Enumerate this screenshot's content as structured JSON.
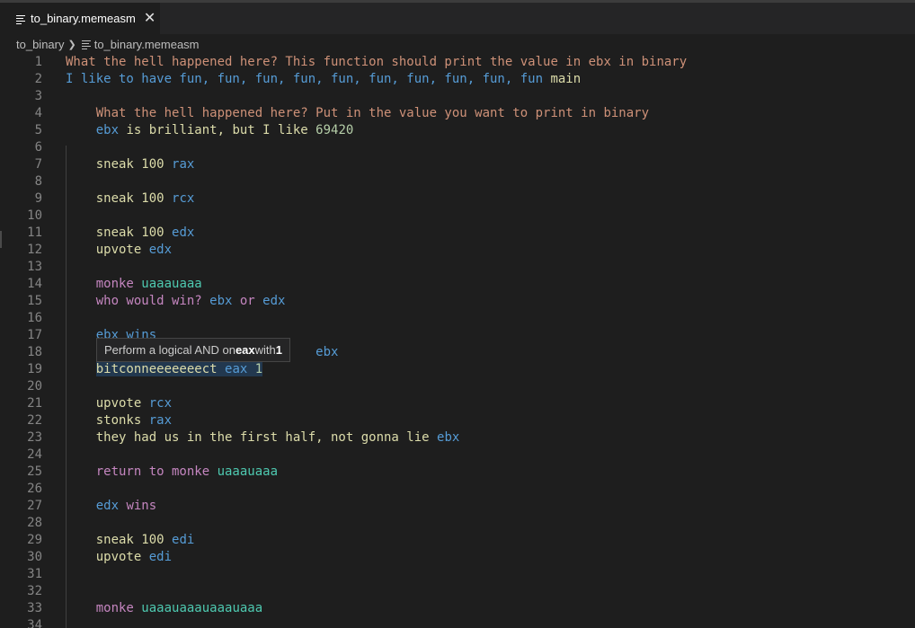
{
  "tab": {
    "label": "to_binary.memeasm",
    "close": "✕"
  },
  "breadcrumb": {
    "folder": "to_binary",
    "file": "to_binary.memeasm"
  },
  "tooltip": {
    "pre": "Perform a logical AND on ",
    "reg": "eax",
    "mid": " with ",
    "val": "1"
  },
  "lines": [
    {
      "n": "1",
      "tokens": [
        {
          "t": "What the hell happened here? This function should print the value in ebx in binary",
          "c": "t-orange"
        }
      ]
    },
    {
      "n": "2",
      "tokens": [
        {
          "t": "I like to have fun, fun, fun, fun, fun, fun, fun, fun, fun, fun ",
          "c": "t-blue"
        },
        {
          "t": "main",
          "c": "t-yellow"
        }
      ]
    },
    {
      "n": "3",
      "tokens": []
    },
    {
      "n": "4",
      "tokens": [
        {
          "t": "    What the hell happened here? Put in the value you want to print in binary",
          "c": "t-orange"
        }
      ]
    },
    {
      "n": "5",
      "tokens": [
        {
          "t": "    ",
          "c": ""
        },
        {
          "t": "ebx",
          "c": "t-blue"
        },
        {
          "t": " is brilliant, but I like ",
          "c": "t-yellow"
        },
        {
          "t": "69420",
          "c": "t-num"
        }
      ]
    },
    {
      "n": "6",
      "tokens": []
    },
    {
      "n": "7",
      "tokens": [
        {
          "t": "    sneak 100 ",
          "c": "t-yellow"
        },
        {
          "t": "rax",
          "c": "t-blue"
        }
      ]
    },
    {
      "n": "8",
      "tokens": []
    },
    {
      "n": "9",
      "tokens": [
        {
          "t": "    sneak 100 ",
          "c": "t-yellow"
        },
        {
          "t": "rcx",
          "c": "t-blue"
        }
      ]
    },
    {
      "n": "10",
      "tokens": []
    },
    {
      "n": "11",
      "tokens": [
        {
          "t": "    sneak 100 ",
          "c": "t-yellow"
        },
        {
          "t": "edx",
          "c": "t-blue"
        }
      ]
    },
    {
      "n": "12",
      "tokens": [
        {
          "t": "    upvote ",
          "c": "t-yellow"
        },
        {
          "t": "edx",
          "c": "t-blue"
        }
      ]
    },
    {
      "n": "13",
      "tokens": []
    },
    {
      "n": "14",
      "tokens": [
        {
          "t": "    monke ",
          "c": "t-purple"
        },
        {
          "t": "uaaauaaa",
          "c": "t-teal"
        }
      ]
    },
    {
      "n": "15",
      "tokens": [
        {
          "t": "    who would win? ",
          "c": "t-purple"
        },
        {
          "t": "ebx",
          "c": "t-blue"
        },
        {
          "t": " or ",
          "c": "t-purple"
        },
        {
          "t": "edx",
          "c": "t-blue"
        }
      ]
    },
    {
      "n": "16",
      "tokens": []
    },
    {
      "n": "17",
      "tokens": [
        {
          "t": "    ",
          "c": ""
        },
        {
          "t": "ebx wins",
          "c": "t-blue"
        }
      ]
    },
    {
      "n": "18",
      "tokens": [
        {
          "t": "                                 ",
          "c": ""
        },
        {
          "t": "ebx",
          "c": "t-blue"
        }
      ]
    },
    {
      "n": "19",
      "tokens": [
        {
          "t": "    ",
          "c": ""
        },
        {
          "t": "bitconneeeeeeect ",
          "c": "t-yellow hl"
        },
        {
          "t": "eax",
          "c": "t-blue hl"
        },
        {
          "t": " ",
          "c": "hl"
        },
        {
          "t": "1",
          "c": "t-num hl"
        }
      ]
    },
    {
      "n": "20",
      "tokens": []
    },
    {
      "n": "21",
      "tokens": [
        {
          "t": "    upvote ",
          "c": "t-yellow"
        },
        {
          "t": "rcx",
          "c": "t-blue"
        }
      ]
    },
    {
      "n": "22",
      "tokens": [
        {
          "t": "    stonks ",
          "c": "t-yellow"
        },
        {
          "t": "rax",
          "c": "t-blue"
        }
      ]
    },
    {
      "n": "23",
      "tokens": [
        {
          "t": "    they had us in the first half, not gonna lie ",
          "c": "t-yellow"
        },
        {
          "t": "ebx",
          "c": "t-blue"
        }
      ]
    },
    {
      "n": "24",
      "tokens": []
    },
    {
      "n": "25",
      "tokens": [
        {
          "t": "    return to monke ",
          "c": "t-purple"
        },
        {
          "t": "uaaauaaa",
          "c": "t-teal"
        }
      ]
    },
    {
      "n": "26",
      "tokens": []
    },
    {
      "n": "27",
      "tokens": [
        {
          "t": "    ",
          "c": ""
        },
        {
          "t": "edx",
          "c": "t-blue"
        },
        {
          "t": " wins",
          "c": "t-purple"
        }
      ]
    },
    {
      "n": "28",
      "tokens": []
    },
    {
      "n": "29",
      "tokens": [
        {
          "t": "    sneak 100 ",
          "c": "t-yellow"
        },
        {
          "t": "edi",
          "c": "t-blue"
        }
      ]
    },
    {
      "n": "30",
      "tokens": [
        {
          "t": "    upvote ",
          "c": "t-yellow"
        },
        {
          "t": "edi",
          "c": "t-blue"
        }
      ]
    },
    {
      "n": "31",
      "tokens": []
    },
    {
      "n": "32",
      "tokens": []
    },
    {
      "n": "33",
      "tokens": [
        {
          "t": "    monke ",
          "c": "t-purple"
        },
        {
          "t": "uaaauaaauaaauaaa",
          "c": "t-teal"
        }
      ]
    },
    {
      "n": "34",
      "tokens": []
    }
  ]
}
